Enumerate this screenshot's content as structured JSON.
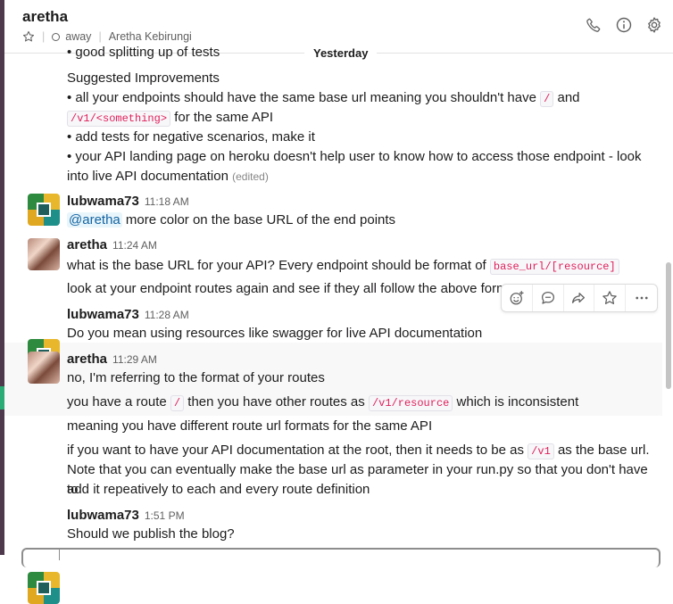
{
  "channel": {
    "name": "aretha",
    "status": "away",
    "full_name": "Aretha Kebirungi"
  },
  "header_icons": [
    "phone-icon",
    "info-icon",
    "gear-icon"
  ],
  "day_divider": "Yesterday",
  "cut_off_line": "• good splitting up of tests",
  "block1": {
    "heading": "Suggested Improvements",
    "b1_pre": "• all your endpoints should have the same base url meaning you shouldn't have ",
    "b1_code1": "/",
    "b1_mid": " and",
    "b1_code2": "/v1/<something>",
    "b1_post": " for the same API",
    "b2": "• add tests for negative scenarios, make it",
    "b3_line1": "• your API landing page on heroku doesn't help user to know how to access those endpoint - look",
    "b3_line2": "into live API documentation",
    "edited": "(edited)"
  },
  "msg1": {
    "author": "lubwama73",
    "time": "11:18 AM",
    "mention": "@aretha",
    "text": " more color on the base URL of the end points"
  },
  "msg2": {
    "author": "aretha",
    "time": "11:24 AM",
    "text1_pre": "what is the base URL for your API? Every endpoint should be format of ",
    "text1_code": "base_url/[resource]",
    "text2": "look at your endpoint routes again and see if they all follow the above format"
  },
  "msg3": {
    "author": "lubwama73",
    "time": "11:28 AM",
    "text": "Do you mean using resources like swagger for live API documentation"
  },
  "msg4": {
    "author": "aretha",
    "time": "11:29 AM",
    "text1": "no, I'm referring to the format of your routes",
    "text2_pre": "you have a route ",
    "text2_code1": "/",
    "text2_mid": " then you have other routes as ",
    "text2_code2": "/v1/resource",
    "text2_post": " which is inconsistent",
    "text3": "meaning you have different route url formats for the same API",
    "text4_pre": "if you want to have your API documentation at the root, then it needs to be as ",
    "text4_code": "/v1",
    "text4_post": " as the base url.",
    "text4_line2": "Note that you can eventually make the base url as parameter in your run.py so that you don't have to",
    "text4_line3": "add it repeatively to each and every route definition"
  },
  "msg5": {
    "author": "lubwama73",
    "time": "1:51 PM",
    "text": "Should we publish the blog?"
  },
  "message_actions": [
    "add-reaction-icon",
    "start-thread-icon",
    "share-message-icon",
    "save-star-icon",
    "more-actions-icon"
  ],
  "colors": {
    "sidebar": "#4d394b",
    "sidebar_accent": "#2bac76",
    "code_text": "#e01e5a",
    "mention": "#1264a3"
  }
}
